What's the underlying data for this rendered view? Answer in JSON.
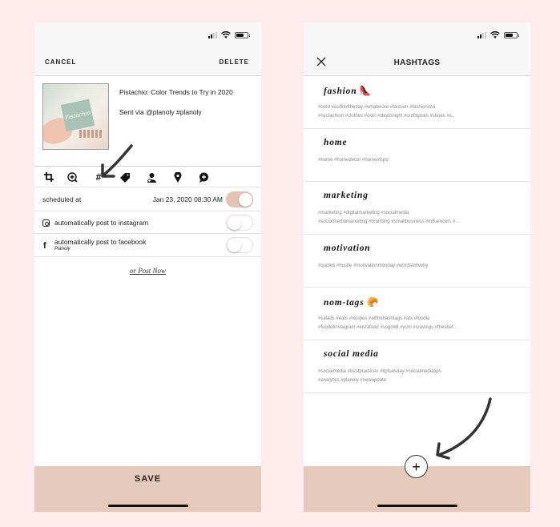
{
  "left_screen": {
    "nav": {
      "cancel_label": "CANCEL",
      "delete_label": "DELETE"
    },
    "post": {
      "thumbnail_text": "Pistachio",
      "title": "Pistachio: Color Trends to Try in 2020",
      "caption": "Sent via @planoly #planoly"
    },
    "toolbar": {
      "icons": [
        "crop-icon",
        "add-circle-icon",
        "hashtag-icon",
        "tag-icon",
        "user-tag-icon",
        "location-pin-icon",
        "add-comment-icon"
      ],
      "hashtag_glyph": "#"
    },
    "schedule": {
      "label": "scheduled at",
      "value": "Jan 23, 2020 08:30 AM",
      "enabled": true
    },
    "instagram_row": {
      "label": "automatically post to instagram",
      "enabled": false
    },
    "facebook_row": {
      "label": "automatically post to facebook",
      "sublabel": "Planoly",
      "icon_glyph": "f",
      "enabled": false
    },
    "post_now_label": "or Post Now",
    "save_label": "SAVE"
  },
  "right_screen": {
    "title": "HASHTAGS",
    "groups": [
      {
        "name": "fashion",
        "emoji": "👠",
        "tags_line1": "#ootd #outfitoftheday #whatiwore #fashion #fashionista",
        "tags_line2": "#nycfashion #clothes #ootn #daytonight #outfitgoals #shoes #s.."
      },
      {
        "name": "home",
        "emoji": "",
        "tags_line1": "#home #homedecor #homeinspo",
        "tags_line2": ""
      },
      {
        "name": "marketing",
        "emoji": "",
        "tags_line1": "#marketing #digitalmarketing #socialmedia",
        "tags_line2": "#socialmediamarketing #branding #smallbusiness #influencers #..."
      },
      {
        "name": "motivation",
        "emoji": "",
        "tags_line1": "#quotes #hustle #motivationmonday #wordstoliveby",
        "tags_line2": ""
      },
      {
        "name": "nom-tags",
        "emoji": "🥐",
        "tags_line1": "#salads #eats #recipes #allthehashtags #atx #foodie",
        "tags_line2": "#foodofinstagram #instafood #sogood #yum #cravings #friesbef.."
      },
      {
        "name": "social media",
        "emoji": "",
        "tags_line1": "#socialmedia #bestpractices #tiptuesday #socialmediatips",
        "tags_line2": "#analytics #planoly #newupdate"
      }
    ],
    "add_glyph": "+"
  },
  "colors": {
    "page_background": "#fdeceb",
    "accent_blush": "#e5c9bb",
    "toggle_on": "#e5c3b2",
    "nav_background": "#f7f7f7"
  }
}
